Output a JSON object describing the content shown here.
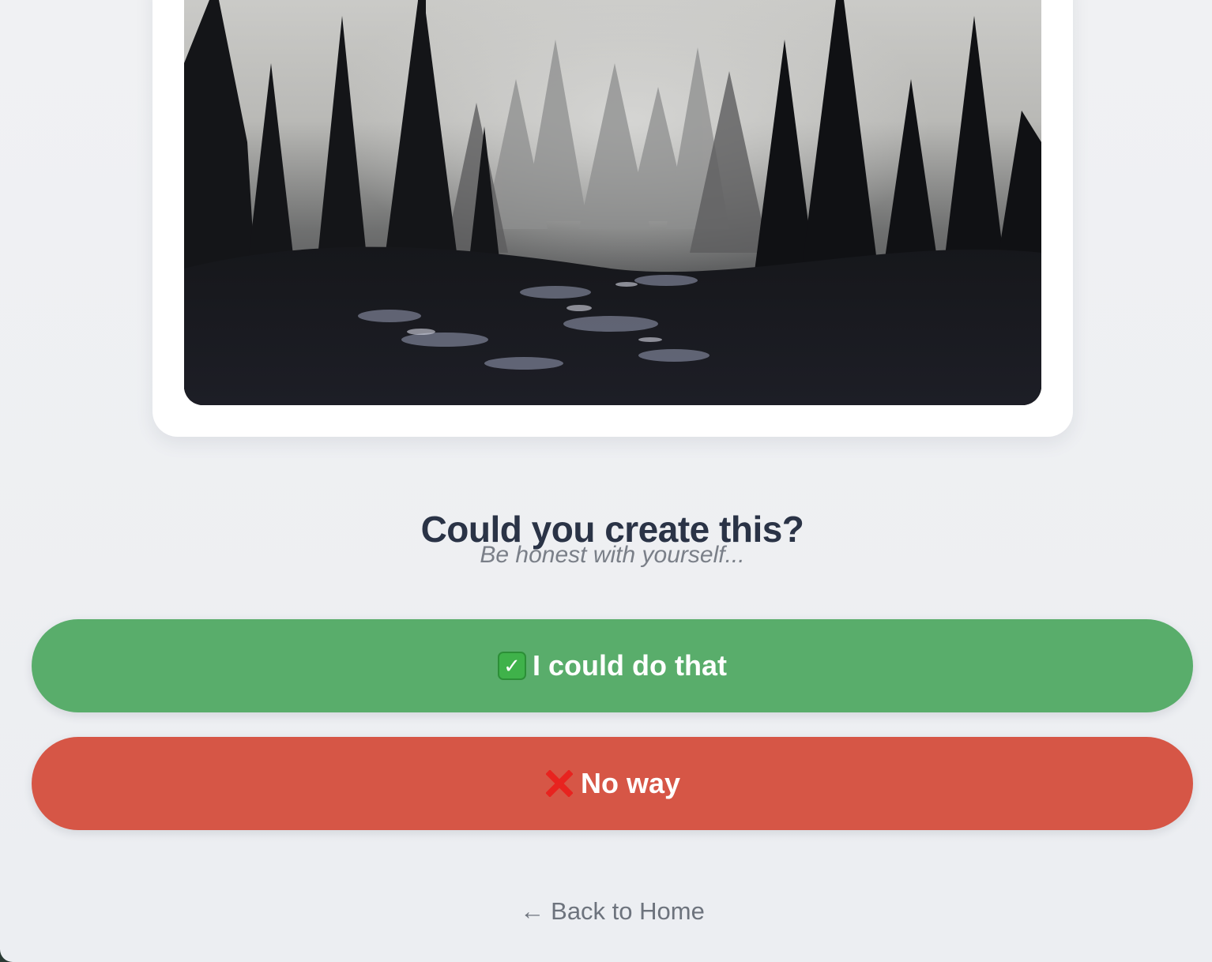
{
  "prompt": {
    "question": "Could you create this?",
    "hint": "Be honest with yourself..."
  },
  "artwork": {
    "subject": "misty pine forest photograph"
  },
  "choices": {
    "yes_label": "I could do that",
    "yes_icon": "check-mark-icon",
    "yes_color": "#59ad6b",
    "no_label": "No way",
    "no_icon": "cross-mark-icon",
    "no_color": "#d65646"
  },
  "footer": {
    "back_arrow": "←",
    "back_label": "Back to Home"
  },
  "colors": {
    "background": "#eef0f3",
    "heading": "#2a3346",
    "muted": "#7a7f88"
  }
}
